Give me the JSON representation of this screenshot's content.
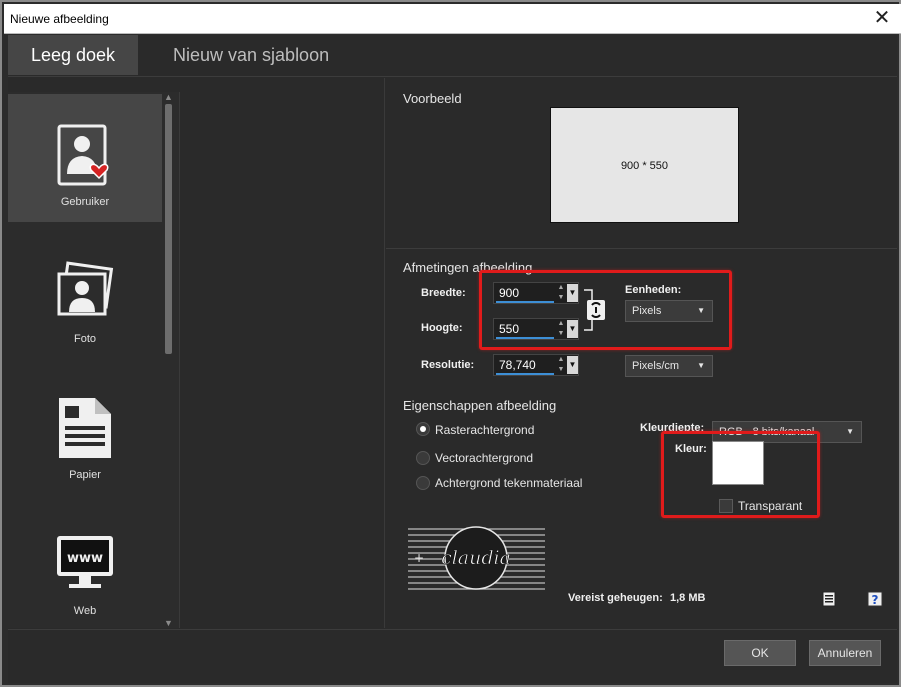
{
  "window": {
    "title": "Nieuwe afbeelding",
    "close_glyph": "✕"
  },
  "tabs": [
    {
      "label": "Leeg doek",
      "active": true
    },
    {
      "label": "Nieuw van sjabloon",
      "active": false
    }
  ],
  "sidebar": {
    "items": [
      {
        "label": "Gebruiker",
        "icon": "user-heart-icon",
        "selected": true
      },
      {
        "label": "Foto",
        "icon": "photo-icon",
        "selected": false
      },
      {
        "label": "Papier",
        "icon": "paper-icon",
        "selected": false
      },
      {
        "label": "Web",
        "icon": "web-monitor-icon",
        "selected": false
      }
    ]
  },
  "preview": {
    "title": "Voorbeeld",
    "dimensions_text": "900 * 550"
  },
  "dimensions": {
    "title": "Afmetingen afbeelding",
    "width_label": "Breedte:",
    "width_value": "900",
    "height_label": "Hoogte:",
    "height_value": "550",
    "resolution_label": "Resolutie:",
    "resolution_value": "78,740",
    "units_label": "Eenheden:",
    "units_value": "Pixels",
    "resolution_units_value": "Pixels/cm"
  },
  "properties": {
    "title": "Eigenschappen afbeelding",
    "options": [
      {
        "label": "Rasterachtergrond",
        "selected": true
      },
      {
        "label": "Vectorachtergrond",
        "selected": false
      },
      {
        "label": "Achtergrond tekenmateriaal",
        "selected": false
      }
    ],
    "color_depth_label": "Kleurdiepte:",
    "color_depth_value": "RGB - 8 bits/kanaal",
    "color_label": "Kleur:",
    "color_value": "#ffffff",
    "transparent_label": "Transparant",
    "transparent_checked": false
  },
  "memory": {
    "label": "Vereist geheugen:",
    "value": "1,8 MB"
  },
  "watermark": {
    "text": "claudia"
  },
  "buttons": {
    "ok": "OK",
    "cancel": "Annuleren"
  },
  "colors": {
    "accent": "#3d8fd6",
    "highlight": "#e01b1b",
    "background": "#2a2a2a"
  }
}
